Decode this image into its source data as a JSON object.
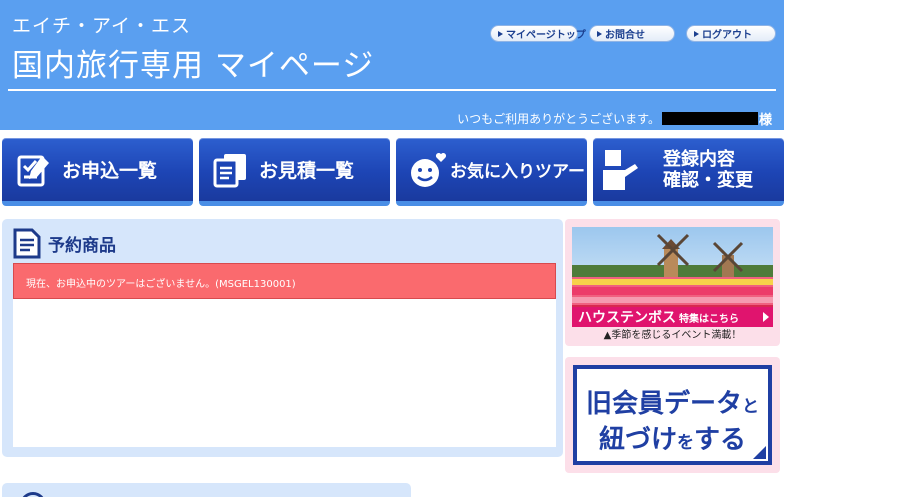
{
  "header": {
    "company": "エイチ・アイ・エス",
    "title": "国内旅行専用 マイページ",
    "links": {
      "mypage_top": "マイページトップ",
      "contact": "お問合せ",
      "logout": "ログアウト"
    },
    "greeting": "いつもご利用ありがとうございます。",
    "honorific": "様"
  },
  "nav": {
    "applications": "お申込一覧",
    "quotes": "お見積一覧",
    "favorites": "お気に入りツアー",
    "registration_line1": "登録内容",
    "registration_line2": "確認・変更"
  },
  "reservations": {
    "title": "予約商品",
    "message": "現在、お申込中のツアーはございません。(MSGEL130001)"
  },
  "banners": {
    "huis_ten_bosch": {
      "name": "ハウステンボス",
      "link": "特集はこちら",
      "caption": "▲季節を感じるイベント満載！"
    },
    "legacy_member": {
      "line1_main": "旧会員データ",
      "line1_small": "と",
      "line2_main1": "紐づけ",
      "line2_small": "を",
      "line2_main2": "する"
    }
  },
  "colors": {
    "header_bg": "#5a9ff0",
    "nav_bg": "#1d45b5",
    "alert_bg": "#fa6a6e",
    "panel_bg": "#d6e6fb",
    "banner_bg": "#fcdfe9",
    "accent_blue": "#1f3fa3"
  }
}
